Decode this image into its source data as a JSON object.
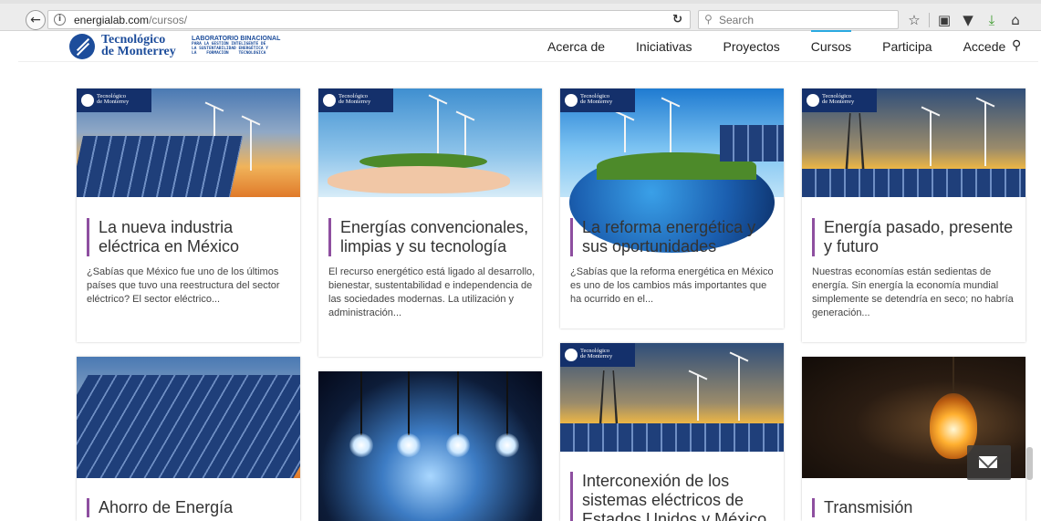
{
  "browser": {
    "url_host": "energialab.com",
    "url_path": "/cursos/",
    "search_placeholder": "Search"
  },
  "header": {
    "logo_line1": "Tecnológico",
    "logo_line2": "de Monterrey",
    "lab_title": "LABORATORIO BINACIONAL",
    "lab_subtitle": "PARA LA GESTIÓN INTELIGENTE DE\nLA SUSTENTABILIDAD ENERGÉTICA Y\nLA    FORMACIÓN    TECNOLÓGICA",
    "nav": [
      "Acerca de",
      "Iniciativas",
      "Proyectos",
      "Cursos",
      "Participa",
      "Accede"
    ],
    "active_nav": "Cursos"
  },
  "brand_tag": {
    "line1": "Tecnológico",
    "line2": "de Monterrey"
  },
  "cards": [
    {
      "title": "La nueva industria eléctrica en México",
      "text": "¿Sabías que México fue uno de los últimos países que tuvo una reestructura del sector eléctrico? El sector eléctrico..."
    },
    {
      "title": "Energías convencionales, limpias y su tecnología",
      "text": "El recurso energético está ligado al desarrollo, bienestar, sustentabilidad e independencia de las sociedades modernas. La utilización y administración..."
    },
    {
      "title": "La reforma energética y sus oportunidades",
      "text": "¿Sabías que la reforma energética en México es uno de los cambios más importantes que ha ocurrido en el..."
    },
    {
      "title": "Energía pasado, presente y futuro",
      "text": "Nuestras economías están sedientas de energía. Sin energía la economía mundial simplemente se detendría en seco; no habría generación..."
    },
    {
      "title": "Ahorro de Energía",
      "text": ""
    },
    {
      "title": "",
      "text": ""
    },
    {
      "title": "Interconexión de los sistemas eléctricos de Estados Unidos y México",
      "text": ""
    },
    {
      "title": "Transmisión",
      "text": ""
    }
  ],
  "colors": {
    "accent_bar": "#8e4fa0",
    "brand_blue": "#1d4d9b",
    "active_nav_line": "#29a9e0"
  },
  "icons": {
    "back": "back-arrow-icon",
    "info": "info-icon",
    "reload": "reload-icon",
    "search": "search-icon",
    "bookmark": "star-icon",
    "clipboard": "clipboard-icon",
    "pocket": "pocket-icon",
    "download": "download-icon",
    "home": "home-icon",
    "site_search": "search-icon",
    "mail": "mail-icon"
  }
}
